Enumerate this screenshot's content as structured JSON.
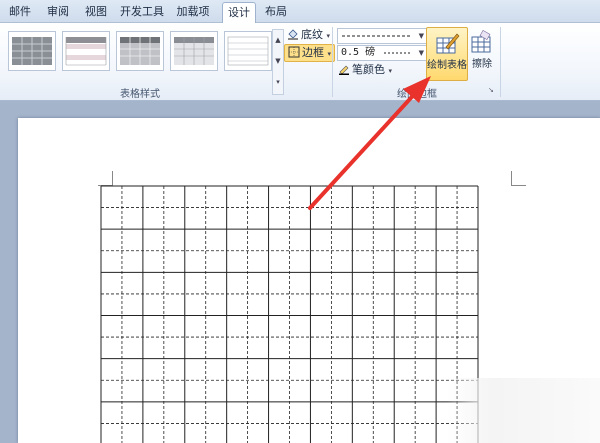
{
  "tabs": [
    "邮件",
    "审阅",
    "视图",
    "开发工具",
    "加载项",
    "设计",
    "布局"
  ],
  "active_tab": "设计",
  "ribbon": {
    "table_styles_label": "表格样式",
    "draw_borders_label": "绘图边框",
    "shading_label": "底纹",
    "borders_label": "边框",
    "pen_weight_value": "0.5 磅",
    "pen_color_label": "笔颜色",
    "draw_table_label": "绘制表格",
    "eraser_label": "擦除"
  },
  "colors": {
    "accent": "#ffd96e",
    "arrow": "#e8322b",
    "ribbon_bg": "#f3f7fc",
    "grid_line": "#222222"
  },
  "icons": {
    "shading": "paint-bucket-icon",
    "borders": "borders-icon",
    "pen_color": "pen-icon",
    "draw_table": "pencil-table-icon",
    "eraser": "eraser-icon"
  },
  "table": {
    "visible_columns": 18,
    "visible_rows": 12
  }
}
